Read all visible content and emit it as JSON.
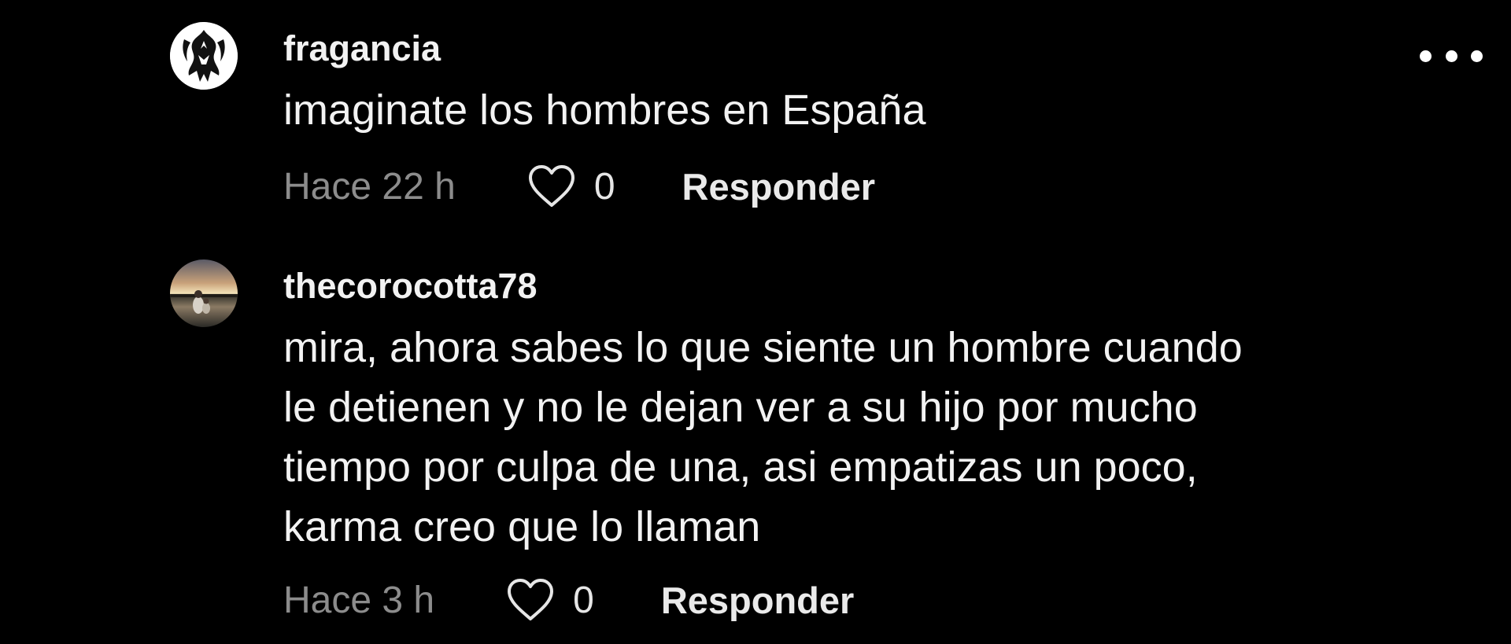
{
  "comments": [
    {
      "username": "fragancia",
      "lines": [
        "imaginate los hombres en España"
      ],
      "time": "Hace 22 h",
      "likes": "0",
      "reply_label": "Responder",
      "avatar_icon": "dragon-emblem-icon"
    },
    {
      "username": "thecorocotta78",
      "lines": [
        "mira, ahora sabes lo que siente un hombre cuando",
        "le detienen y no le dejan ver a su hijo por mucho",
        "tiempo por culpa de una, asi empatizas un poco,",
        "karma creo que lo llaman"
      ],
      "time": "Hace 3 h",
      "likes": "0",
      "reply_label": "Responder",
      "avatar_icon": "sunset-photo-avatar"
    }
  ],
  "more_icon": "more-options-icon",
  "like_icon": "heart-outline-icon",
  "colors": {
    "background": "#000000",
    "text": "#f2f2f2",
    "muted": "#8c8c8c"
  }
}
